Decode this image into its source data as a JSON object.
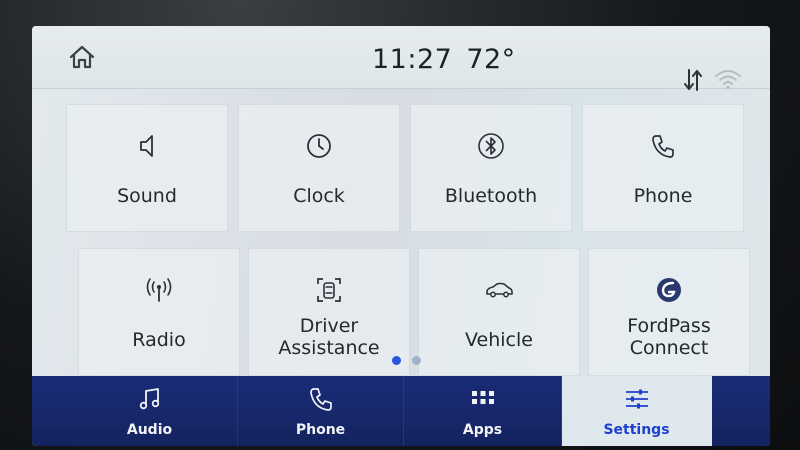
{
  "status": {
    "time": "11:27",
    "temperature": "72°"
  },
  "icons": {
    "home": "home-icon",
    "sync": "sync-arrows-icon",
    "wifi": "wifi-icon"
  },
  "tiles": [
    {
      "name": "sound",
      "label": "Sound",
      "icon": "speaker-icon"
    },
    {
      "name": "clock",
      "label": "Clock",
      "icon": "clock-icon"
    },
    {
      "name": "bluetooth",
      "label": "Bluetooth",
      "icon": "bluetooth-icon"
    },
    {
      "name": "phone",
      "label": "Phone",
      "icon": "phone-icon"
    },
    {
      "name": "radio",
      "label": "Radio",
      "icon": "antenna-icon"
    },
    {
      "name": "driver-assistance",
      "label_line1": "Driver",
      "label_line2": "Assistance",
      "icon": "driver-assist-icon"
    },
    {
      "name": "vehicle",
      "label": "Vehicle",
      "icon": "car-icon"
    },
    {
      "name": "fordpass-connect",
      "label_line1": "FordPass",
      "label_line2": "Connect",
      "icon": "fordpass-icon"
    }
  ],
  "pager": {
    "pages": 2,
    "current": 1,
    "active_color": "#2a55e0",
    "inactive_color": "#9fb2c8"
  },
  "nav": [
    {
      "name": "audio",
      "label": "Audio",
      "icon": "music-note-icon"
    },
    {
      "name": "phone",
      "label": "Phone",
      "icon": "phone-icon"
    },
    {
      "name": "apps",
      "label": "Apps",
      "icon": "apps-grid-icon"
    },
    {
      "name": "settings",
      "label": "Settings",
      "icon": "sliders-icon",
      "active": true
    }
  ],
  "colors": {
    "nav_bg": "#1a2c78",
    "nav_active_bg": "#dfe8ec",
    "nav_active_text": "#1f3fd0"
  }
}
